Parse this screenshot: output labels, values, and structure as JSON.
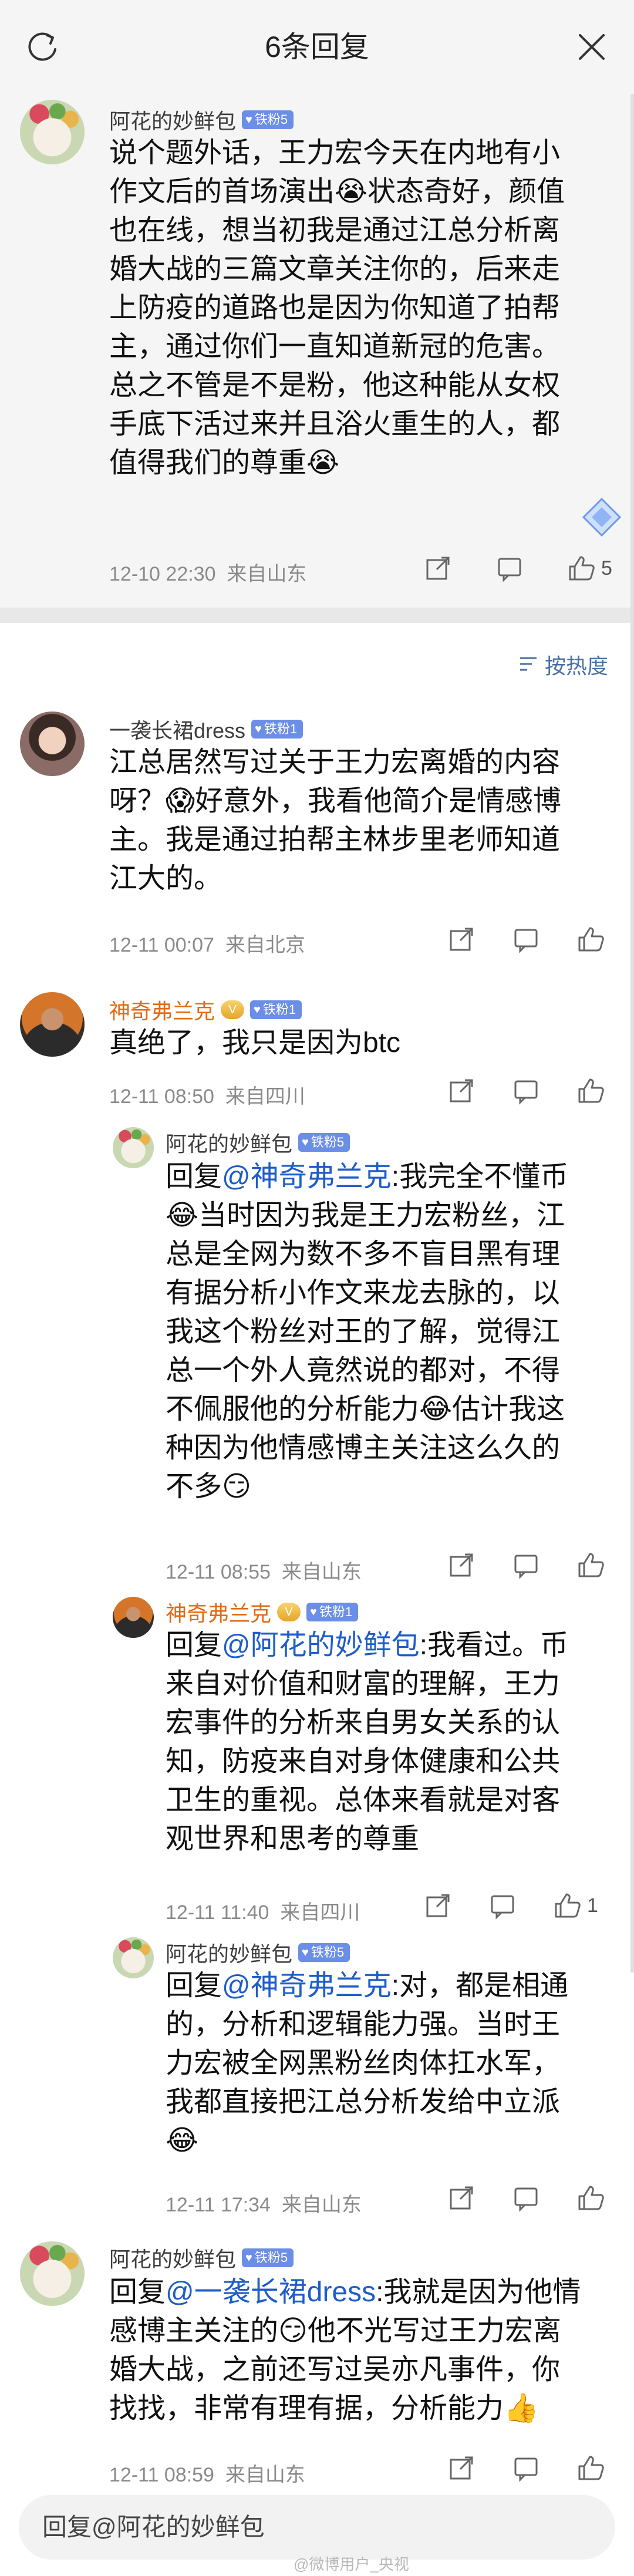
{
  "header": {
    "title": "6条回复"
  },
  "sort": {
    "label": "按热度"
  },
  "comments": [
    {
      "user": "阿花的妙鲜包",
      "badge": "铁粉5",
      "lines": [
        "说个题外话，王力宏今天在内地有小",
        "作文后的首场演出😭状态奇好，颜值",
        "也在线，想当初我是通过江总分析离",
        "婚大战的三篇文章关注你的，后来走",
        "上防疫的道路也是因为你知道了拍帮",
        "主，通过你们一直知道新冠的危害。",
        "总之不管是不是粉，他这种能从女权",
        "手底下活过来并且浴火重生的人，都",
        "值得我们的尊重😭"
      ],
      "time": "12-10 22:30",
      "location": "来自山东",
      "likes": "5"
    },
    {
      "user": "一袭长裙dress",
      "badge": "铁粉1",
      "lines": [
        "江总居然写过关于王力宏离婚的内容",
        "呀？😱好意外，我看他简介是情感博",
        "主。我是通过拍帮主林步里老师知道",
        "江大的。"
      ],
      "time": "12-11 00:07",
      "location": "来自北京",
      "likes": ""
    },
    {
      "user": "神奇弗兰克",
      "badge": "铁粉1",
      "lines": [
        "真绝了，我只是因为btc"
      ],
      "time": "12-11 08:50",
      "location": "来自四川",
      "likes": ""
    },
    {
      "user": "阿花的妙鲜包",
      "badge": "铁粉5",
      "reply_prefix": "回复",
      "reply_to": "@神奇弗兰克",
      "lines": [
        ":我完全不懂币",
        "😂当时因为我是王力宏粉丝，江",
        "总是全网为数不多不盲目黑有理",
        "有据分析小作文来龙去脉的，以",
        "我这个粉丝对王的了解，觉得江",
        "总一个外人竟然说的都对，不得",
        "不佩服他的分析能力😂估计我这",
        "种因为他情感博主关注这么久的",
        "不多😏"
      ],
      "time": "12-11 08:55",
      "location": "来自山东",
      "likes": ""
    },
    {
      "user": "神奇弗兰克",
      "badge": "铁粉1",
      "reply_prefix": "回复",
      "reply_to": "@阿花的妙鲜包",
      "lines": [
        ":我看过。币",
        "来自对价值和财富的理解，王力",
        "宏事件的分析来自男女关系的认",
        "知，防疫来自对身体健康和公共",
        "卫生的重视。总体来看就是对客",
        "观世界和思考的尊重"
      ],
      "time": "12-11 11:40",
      "location": "来自四川",
      "likes": "1"
    },
    {
      "user": "阿花的妙鲜包",
      "badge": "铁粉5",
      "reply_prefix": "回复",
      "reply_to": "@神奇弗兰克",
      "lines": [
        ":对，都是相通",
        "的，分析和逻辑能力强。当时王",
        "力宏被全网黑粉丝肉体扛水军，",
        "我都直接把江总分析发给中立派",
        "😂"
      ],
      "time": "12-11 17:34",
      "location": "来自山东",
      "likes": ""
    },
    {
      "user": "阿花的妙鲜包",
      "badge": "铁粉5",
      "reply_prefix": "回复",
      "reply_to": "@一袭长裙dress",
      "lines": [
        ":我就是因为他情",
        "感博主关注的😏他不光写过王力宏离",
        "婚大战，之前还写过吴亦凡事件，你",
        "找找，非常有理有据，分析能力👍"
      ],
      "time": "12-11 08:59",
      "location": "来自山东",
      "likes": ""
    }
  ],
  "reply_bar": {
    "placeholder": "回复@阿花的妙鲜包"
  },
  "watermark": "@微博用户_央视"
}
